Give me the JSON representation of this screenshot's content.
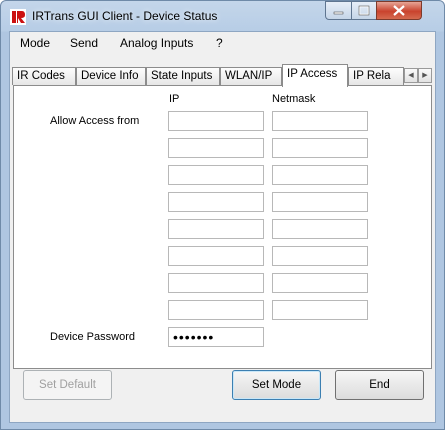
{
  "window": {
    "title": "IRTrans GUI Client - Device Status",
    "colors": {
      "frame": "#b7cde6",
      "close": "#c9432d",
      "client": "#f0f0f0"
    }
  },
  "menu": [
    "Mode",
    "Send",
    "Analog Inputs",
    "?"
  ],
  "tabs": [
    "IR Codes",
    "Device Info",
    "State Inputs",
    "WLAN/IP",
    "IP Access",
    "IP Rela"
  ],
  "active_tab": "IP Access",
  "access": {
    "ip_header": "IP",
    "netmask_header": "Netmask",
    "allow_label": "Allow Access from",
    "rows": [
      {
        "ip": "",
        "netmask": ""
      },
      {
        "ip": "",
        "netmask": ""
      },
      {
        "ip": "",
        "netmask": ""
      },
      {
        "ip": "",
        "netmask": ""
      },
      {
        "ip": "",
        "netmask": ""
      },
      {
        "ip": "",
        "netmask": ""
      },
      {
        "ip": "",
        "netmask": ""
      },
      {
        "ip": "",
        "netmask": ""
      }
    ],
    "password_label": "Device Password",
    "password_value": "•••••••"
  },
  "buttons": {
    "set_default": "Set Default",
    "set_mode": "Set Mode",
    "end": "End"
  }
}
